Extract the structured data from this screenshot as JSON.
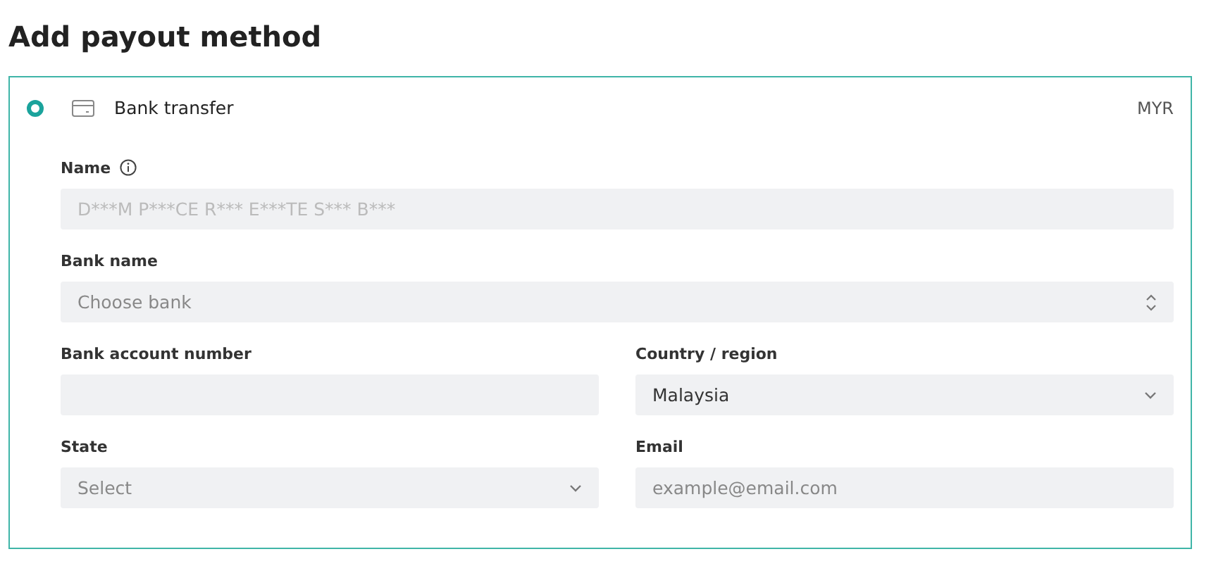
{
  "title": "Add payout method",
  "method": {
    "label": "Bank transfer",
    "selected": true,
    "currency": "MYR"
  },
  "rows": [
    [
      {
        "label": "Name",
        "info": true,
        "kind": "readonly",
        "value": "D***M P***CE R*** E***TE S*** B***"
      }
    ],
    [
      {
        "label": "Bank name",
        "kind": "combobox",
        "placeholder": "Choose bank"
      }
    ],
    [
      {
        "label": "Bank account number",
        "kind": "text"
      },
      {
        "label": "Country / region",
        "kind": "select",
        "value": "Malaysia"
      }
    ],
    [
      {
        "label": "State",
        "kind": "select",
        "placeholder": "Select"
      },
      {
        "label": "Email",
        "kind": "text",
        "placeholder": "example@email.com"
      }
    ]
  ]
}
